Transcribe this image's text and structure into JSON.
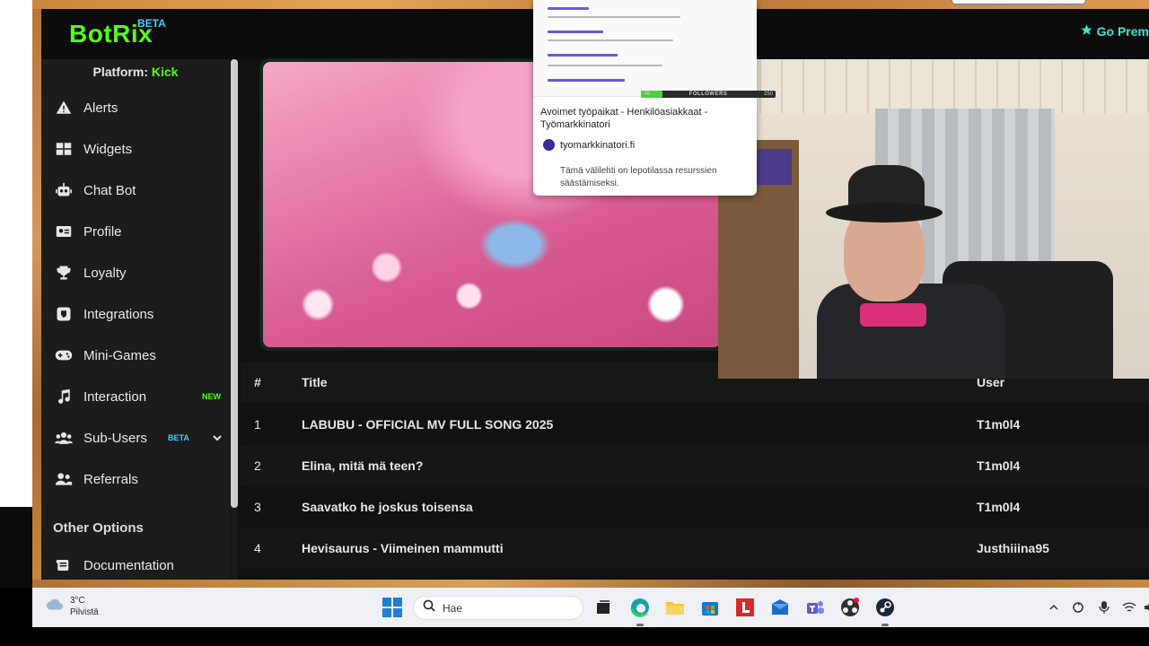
{
  "app": {
    "logo": "BotRix",
    "logo_badge": "BETA",
    "go_premium": "Go Prem"
  },
  "sidebar": {
    "platform_label": "Platform:",
    "platform_value": "Kick",
    "items": [
      {
        "label": "Alerts",
        "icon": "warning-icon"
      },
      {
        "label": "Widgets",
        "icon": "grid-icon"
      },
      {
        "label": "Chat Bot",
        "icon": "robot-icon"
      },
      {
        "label": "Profile",
        "icon": "id-card-icon"
      },
      {
        "label": "Loyalty",
        "icon": "trophy-icon"
      },
      {
        "label": "Integrations",
        "icon": "plug-icon"
      },
      {
        "label": "Mini-Games",
        "icon": "gamepad-icon"
      },
      {
        "label": "Interaction",
        "icon": "music-icon",
        "badge": "NEW"
      },
      {
        "label": "Sub-Users",
        "icon": "users-icon",
        "badge": "BETA"
      },
      {
        "label": "Referrals",
        "icon": "user-group-icon"
      }
    ],
    "other_options": "Other Options",
    "documentation": "Documentation"
  },
  "table": {
    "headers": {
      "num": "#",
      "title": "Title",
      "user": "User"
    },
    "rows": [
      {
        "num": "1",
        "title": "LABUBU - OFFICIAL MV FULL SONG 2025",
        "user": "T1m0l4"
      },
      {
        "num": "2",
        "title": "Elina, mitä mä teen?",
        "user": "T1m0l4"
      },
      {
        "num": "3",
        "title": "Saavatko he joskus toisensa",
        "user": "T1m0l4"
      },
      {
        "num": "4",
        "title": "Hevisaurus - Viimeinen mammutti",
        "user": "Justhiiina95"
      }
    ]
  },
  "popup": {
    "title": "Avoimet työpaikat - Henkilöasiakkaat - Työmarkkinatori",
    "site": "tyomarkkinatori.fi",
    "note": "Tämä välilehti on lepotilassa resurssien säästämiseksi."
  },
  "follower_bar": {
    "label": "FOLLOWERS",
    "current": "46",
    "goal": "250",
    "progress": 0.16
  },
  "taskbar": {
    "temperature": "3°C",
    "weather": "Pilvistä",
    "search_placeholder": "Hae"
  },
  "colors": {
    "kick_green": "#53fc18",
    "beta_blue": "#3fd0ff",
    "premium": "#3fe3d0"
  }
}
